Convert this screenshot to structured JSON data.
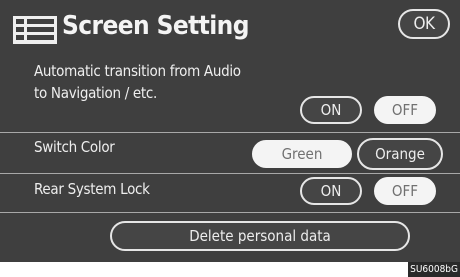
{
  "header": {
    "title": "Screen Setting",
    "ok_label": "OK",
    "icon": "list-icon"
  },
  "settings": {
    "auto_transition": {
      "label_line1": "Automatic transition from Audio",
      "label_line2": "to Navigation / etc.",
      "options": [
        "ON",
        "OFF"
      ],
      "selected": "OFF"
    },
    "switch_color": {
      "label": "Switch Color",
      "options": [
        "Green",
        "Orange"
      ],
      "selected": "Green"
    },
    "rear_system_lock": {
      "label": "Rear System Lock",
      "options": [
        "ON",
        "OFF"
      ],
      "selected": "OFF"
    }
  },
  "delete_label": "Delete personal data",
  "figure_code": "SU6008bG",
  "colors": {
    "background": "#3f3f3f",
    "text": "#f2f2f2",
    "selected_fill": "#f4f4f4",
    "selected_text": "#707070"
  }
}
